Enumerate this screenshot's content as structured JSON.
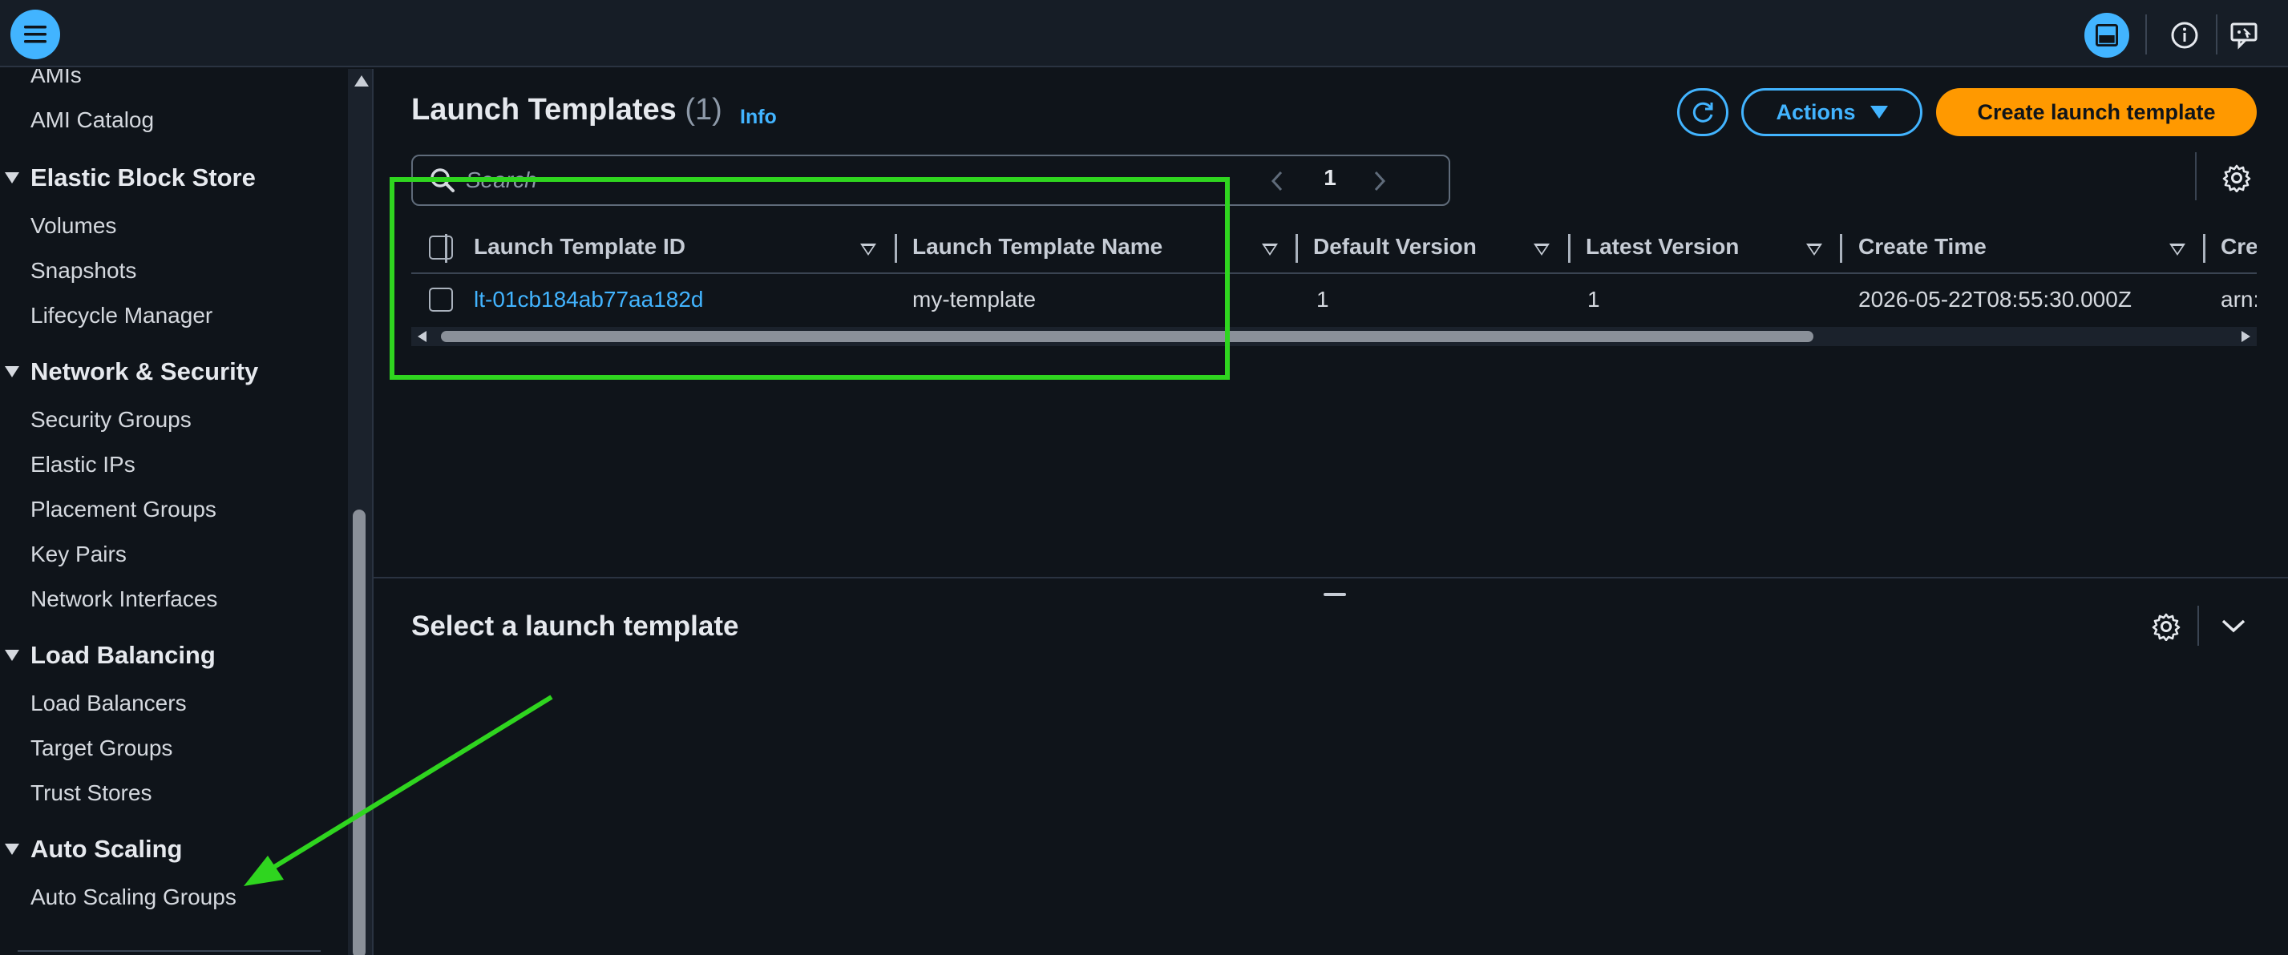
{
  "topbar": {
    "menu_icon": "hamburger-menu-icon",
    "right_icons": [
      "split-panel-icon",
      "info-icon",
      "feedback-icon"
    ]
  },
  "sidebar": {
    "items": [
      {
        "type": "item",
        "label": "AMIs"
      },
      {
        "type": "item",
        "label": "AMI Catalog"
      },
      {
        "type": "section",
        "label": "Elastic Block Store"
      },
      {
        "type": "item",
        "label": "Volumes"
      },
      {
        "type": "item",
        "label": "Snapshots"
      },
      {
        "type": "item",
        "label": "Lifecycle Manager"
      },
      {
        "type": "section",
        "label": "Network & Security"
      },
      {
        "type": "item",
        "label": "Security Groups"
      },
      {
        "type": "item",
        "label": "Elastic IPs"
      },
      {
        "type": "item",
        "label": "Placement Groups"
      },
      {
        "type": "item",
        "label": "Key Pairs"
      },
      {
        "type": "item",
        "label": "Network Interfaces"
      },
      {
        "type": "section",
        "label": "Load Balancing"
      },
      {
        "type": "item",
        "label": "Load Balancers"
      },
      {
        "type": "item",
        "label": "Target Groups"
      },
      {
        "type": "item",
        "label": "Trust Stores"
      },
      {
        "type": "section",
        "label": "Auto Scaling"
      },
      {
        "type": "item",
        "label": "Auto Scaling Groups"
      }
    ]
  },
  "main": {
    "title": "Launch Templates",
    "count": "(1)",
    "info_label": "Info",
    "actions_label": "Actions",
    "create_label": "Create launch template",
    "search_placeholder": "Search",
    "search_value": "",
    "page_number": "1"
  },
  "table": {
    "columns": [
      "Launch Template ID",
      "Launch Template Name",
      "Default Version",
      "Latest Version",
      "Create Time",
      "Creat"
    ],
    "rows": [
      {
        "id": "lt-01cb184ab77aa182d",
        "name": "my-template",
        "default_version": "1",
        "latest_version": "1",
        "create_time": "2026-05-22T08:55:30.000Z",
        "created_by": "arn:av"
      }
    ],
    "horizontal_scroll_fraction": 0.0
  },
  "split_panel": {
    "title": "Select a launch template"
  },
  "colors": {
    "background": "#0f141a",
    "accent": "#42b4ff",
    "primary_button": "#ff9900",
    "annotation": "#2fd51f"
  }
}
